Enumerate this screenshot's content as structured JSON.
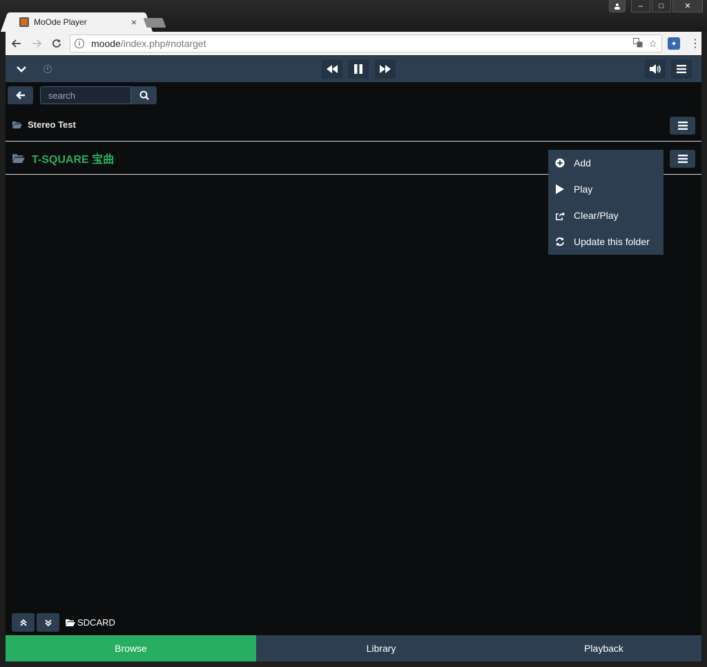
{
  "browser": {
    "tab_title": "MoOde Player",
    "tab_close": "×",
    "url_host": "moode",
    "url_path": "/index.php#notarget",
    "window_controls": [
      "–",
      "□",
      "✕"
    ]
  },
  "player": {
    "controls": [
      "prev-icon",
      "pause-icon",
      "next-icon"
    ]
  },
  "search": {
    "placeholder": "search"
  },
  "folders": [
    {
      "label": "Stereo Test"
    },
    {
      "label": "T-SQUARE 宝曲"
    }
  ],
  "context_menu": {
    "items": [
      {
        "label": "Add",
        "icon": "plus-circle-icon"
      },
      {
        "label": "Play",
        "icon": "play-icon"
      },
      {
        "label": "Clear/Play",
        "icon": "share-icon"
      },
      {
        "label": "Update this folder",
        "icon": "refresh-icon"
      }
    ]
  },
  "path": {
    "label": "SDCARD"
  },
  "tabs": {
    "browse": "Browse",
    "library": "Library",
    "playback": "Playback"
  },
  "colors": {
    "accent": "#27ae60",
    "panel": "#2c3e50",
    "background": "#0c0d0e"
  }
}
